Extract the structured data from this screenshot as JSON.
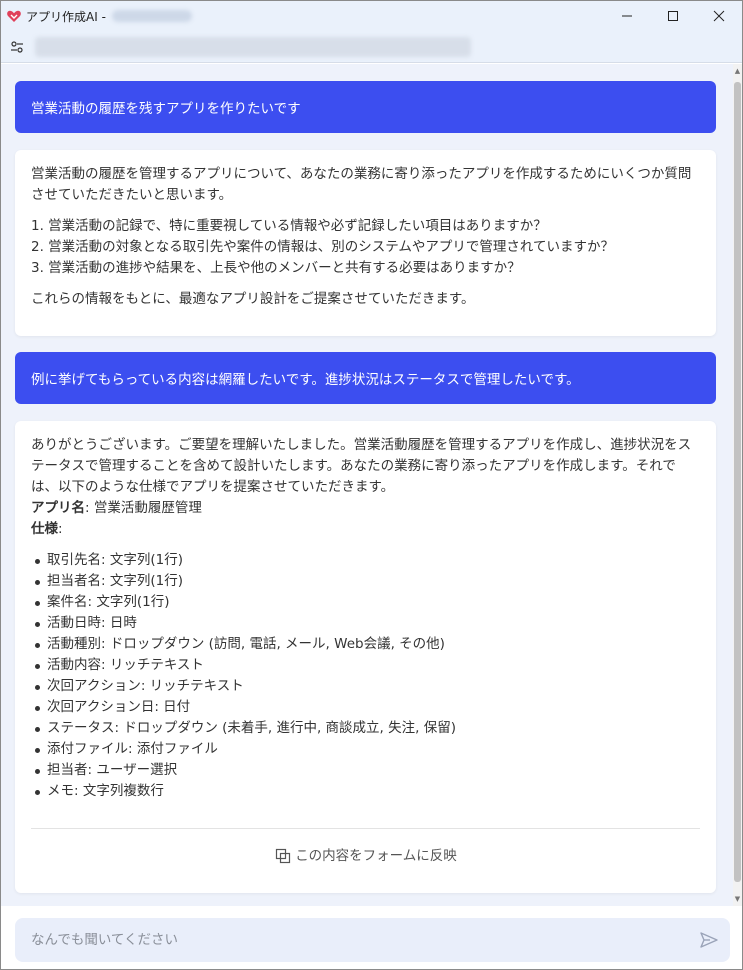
{
  "window": {
    "title": "アプリ作成AI -",
    "minimize_label": "—",
    "maximize_label": "☐",
    "close_label": "✕"
  },
  "messages": {
    "user1": "営業活動の履歴を残すアプリを作りたいです",
    "ai1": {
      "intro": "営業活動の履歴を管理するアプリについて、あなたの業務に寄り添ったアプリを作成するためにいくつか質問させていただきたいと思います。",
      "questions": [
        "1. 営業活動の記録で、特に重要視している情報や必ず記録したい項目はありますか？",
        "2. 営業活動の対象となる取引先や案件の情報は、別のシステムやアプリで管理されていますか？",
        "3. 営業活動の進捗や結果を、上長や他のメンバーと共有する必要はありますか？"
      ],
      "outro": "これらの情報をもとに、最適なアプリ設計をご提案させていただきます。"
    },
    "user2": "例に挙げてもらっている内容は網羅したいです。進捗状況はステータスで管理したいです。",
    "ai2": {
      "intro": "ありがとうございます。ご要望を理解いたしました。営業活動履歴を管理するアプリを作成し、進捗状況をステータスで管理することを含めて設計いたします。あなたの業務に寄り添ったアプリを作成します。それでは、以下のような仕様でアプリを提案させていただきます。",
      "app_name_label": "アプリ名",
      "app_name_value": ": 営業活動履歴管理",
      "spec_label": "仕様",
      "spec_colon": ":",
      "fields": [
        "取引先名: 文字列(1行)",
        "担当者名: 文字列(1行)",
        "案件名: 文字列(1行)",
        "活動日時: 日時",
        "活動種別: ドロップダウン (訪問, 電話, メール, Web会議, その他)",
        "活動内容: リッチテキスト",
        "次回アクション: リッチテキスト",
        "次回アクション日: 日付",
        "ステータス: ドロップダウン (未着手, 進行中, 商談成立, 失注, 保留)",
        "添付ファイル: 添付ファイル",
        "担当者: ユーザー選択",
        "メモ: 文字列複数行"
      ],
      "reflect_label": "この内容をフォームに反映"
    }
  },
  "composer": {
    "placeholder": "なんでも聞いてください"
  },
  "colors": {
    "user_bubble": "#3c4ef0",
    "background": "#eef2fb",
    "logo": "#e0405a"
  }
}
